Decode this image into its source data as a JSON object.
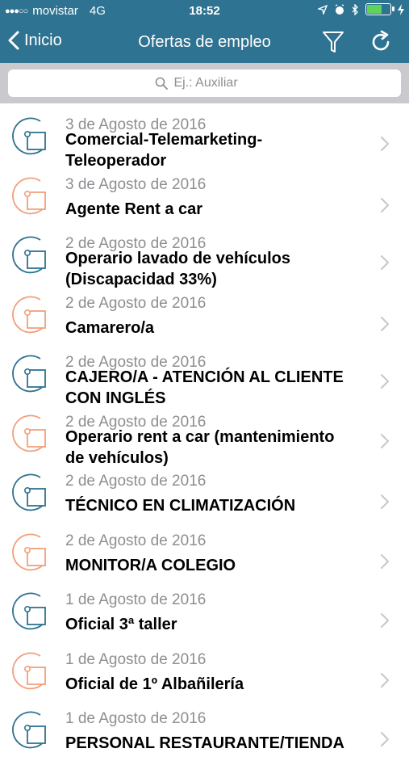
{
  "status_bar": {
    "carrier": "movistar",
    "network": "4G",
    "time": "18:52",
    "battery_color": "#5fd35a"
  },
  "nav": {
    "back_label": "Inicio",
    "title": "Ofertas de empleo"
  },
  "search": {
    "placeholder": "Ej.: Auxiliar"
  },
  "colors": {
    "bar": "#2e7391",
    "icon_blue": "#2e7391",
    "icon_orange": "#f2a07b"
  },
  "jobs": [
    {
      "date": "3 de Agosto de 2016",
      "line1": "Comercial-Telemarketing-",
      "line2": "Teleoperador",
      "icon": "blue"
    },
    {
      "date": "3 de Agosto de 2016",
      "line1": "Agente Rent a car",
      "line2": "",
      "icon": "orange"
    },
    {
      "date": "2 de Agosto de 2016",
      "line1": "Operario lavado de vehículos",
      "line2": "(Discapacidad 33%)",
      "icon": "blue"
    },
    {
      "date": "2 de Agosto de 2016",
      "line1": "Camarero/a",
      "line2": "",
      "icon": "orange"
    },
    {
      "date": "2 de Agosto de 2016",
      "line1": "CAJERO/A  - ATENCIÓN AL CLIENTE",
      "line2": "CON INGLÉS",
      "icon": "blue"
    },
    {
      "date": "2 de Agosto de 2016",
      "line1": "Operario rent a car (mantenimiento",
      "line2": "de vehículos)",
      "icon": "orange"
    },
    {
      "date": "2 de Agosto de 2016",
      "line1": "TÉCNICO EN CLIMATIZACIÓN",
      "line2": "",
      "icon": "blue"
    },
    {
      "date": "2 de Agosto de 2016",
      "line1": "MONITOR/A COLEGIO",
      "line2": "",
      "icon": "orange"
    },
    {
      "date": "1 de Agosto de 2016",
      "line1": "Oficial 3ª taller",
      "line2": "",
      "icon": "blue"
    },
    {
      "date": "1 de Agosto de 2016",
      "line1": "Oficial de 1º Albañilería",
      "line2": "",
      "icon": "orange"
    },
    {
      "date": "1 de Agosto de 2016",
      "line1": "PERSONAL RESTAURANTE/TIENDA",
      "line2": "",
      "icon": "blue"
    }
  ]
}
